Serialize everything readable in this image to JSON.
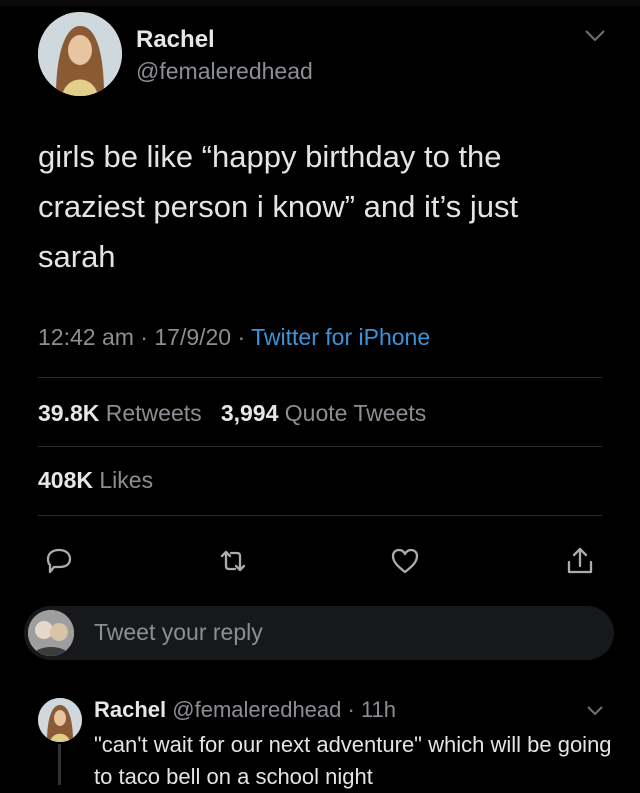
{
  "tweet": {
    "author_name": "Rachel",
    "author_handle": "@femaleredhead",
    "text": "girls be like “happy birthday to the craziest person i know” and it’s just sarah",
    "time": "12:42 am",
    "date": "17/9/20",
    "separator": " · ",
    "source": "Twitter for iPhone"
  },
  "stats": {
    "retweets_count": "39.8K",
    "retweets_label": "Retweets",
    "quotes_count": "3,994",
    "quotes_label": "Quote Tweets",
    "likes_count": "408K",
    "likes_label": "Likes"
  },
  "actions": {
    "reply_icon": "reply-icon",
    "retweet_icon": "retweet-icon",
    "like_icon": "heart-icon",
    "share_icon": "share-icon"
  },
  "reply_box": {
    "placeholder": "Tweet your reply"
  },
  "reply": {
    "author_name": "Rachel",
    "author_handle": "@femaleredhead",
    "time_sep": " · ",
    "time": "11h",
    "text": "\"can't wait for our next adventure\" which will be going to taco bell on a school night"
  },
  "colors": {
    "background": "#000000",
    "link": "#3b94d9",
    "muted": "#8b8f94"
  }
}
